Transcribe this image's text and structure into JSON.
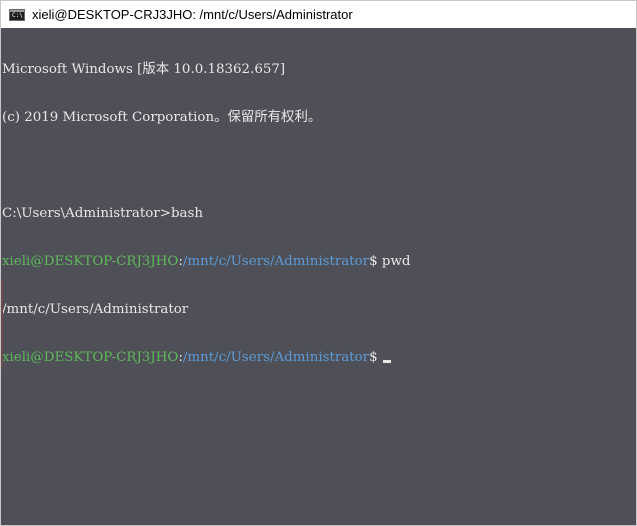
{
  "window": {
    "title": "xieli@DESKTOP-CRJ3JHO: /mnt/c/Users/Administrator",
    "icon_label": "C:\\"
  },
  "console": {
    "line1": "Microsoft Windows [版本 10.0.18362.657]",
    "line2": "(c) 2019 Microsoft Corporation。保留所有权利。",
    "line3": "",
    "line4": "C:\\Users\\Administrator>bash",
    "prompt1": {
      "user": "xieli@DESKTOP-CRJ3JHO",
      "sep": ":",
      "path": "/mnt/c/Users/Administrator",
      "symbol": "$ ",
      "command": "pwd"
    },
    "output1": "/mnt/c/Users/Administrator",
    "prompt2": {
      "user": "xieli@DESKTOP-CRJ3JHO",
      "sep": ":",
      "path": "/mnt/c/Users/Administrator",
      "symbol": "$ ",
      "command": ""
    }
  },
  "colors": {
    "background": "#4f4f57",
    "text": "#e8e8e8",
    "user": "#5fb95b",
    "path": "#5a9bd8"
  }
}
